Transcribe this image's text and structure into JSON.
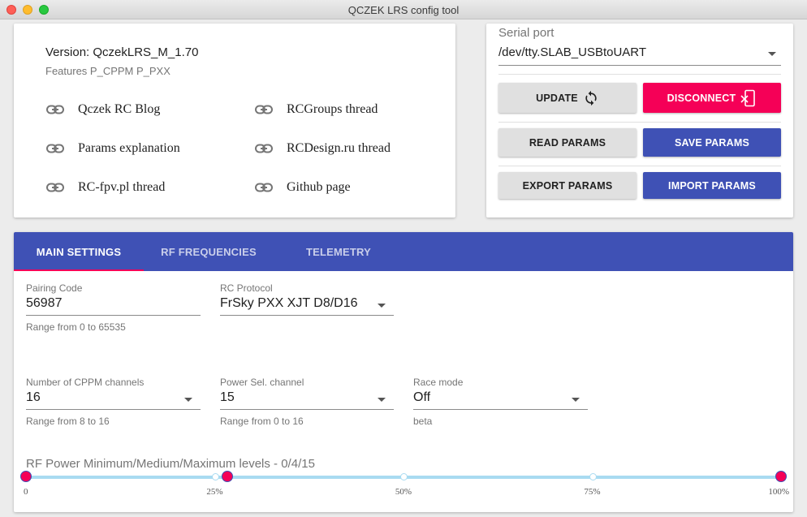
{
  "window": {
    "title": "QCZEK LRS config tool"
  },
  "info": {
    "version": "Version: QczekLRS_M_1.70",
    "features": "Features P_CPPM P_PXX",
    "links": [
      {
        "label": "Qczek RC Blog",
        "icon": "link-icon"
      },
      {
        "label": "RCGroups thread",
        "icon": "link-icon"
      },
      {
        "label": "Params explanation",
        "icon": "link-icon"
      },
      {
        "label": "RCDesign.ru thread",
        "icon": "link-icon"
      },
      {
        "label": "RC-fpv.pl thread",
        "icon": "link-icon"
      },
      {
        "label": "Github page",
        "icon": "link-icon"
      }
    ]
  },
  "serial": {
    "label": "Serial port",
    "value": "/dev/tty.SLAB_USBtoUART",
    "buttons": {
      "update": "UPDATE",
      "disconnect": "DISCONNECT",
      "read": "READ PARAMS",
      "save": "SAVE PARAMS",
      "export": "EXPORT PARAMS",
      "import": "IMPORT PARAMS"
    }
  },
  "tabs": [
    "MAIN SETTINGS",
    "RF FREQUENCIES",
    "TELEMETRY"
  ],
  "settings": {
    "pairing": {
      "label": "Pairing Code",
      "value": "56987",
      "help": "Range from 0 to 65535"
    },
    "protocol": {
      "label": "RC Protocol",
      "value": "FrSky PXX XJT D8/D16"
    },
    "cppm": {
      "label": "Number of CPPM channels",
      "value": "16",
      "help": "Range from 8 to 16"
    },
    "power_sel": {
      "label": "Power Sel. channel",
      "value": "15",
      "help": "Range from 0 to 16"
    },
    "race": {
      "label": "Race mode",
      "value": "Off",
      "help": "beta"
    }
  },
  "rf_power": {
    "title": "RF Power Minimum/Medium/Maximum levels - 0/4/15",
    "marks": [
      "0",
      "25%",
      "50%",
      "75%",
      "100%"
    ],
    "levels": [
      0,
      4,
      15
    ],
    "max": 15
  },
  "colors": {
    "primary": "#3f51b5",
    "accent": "#f50057",
    "track": "#a9dbf1"
  }
}
